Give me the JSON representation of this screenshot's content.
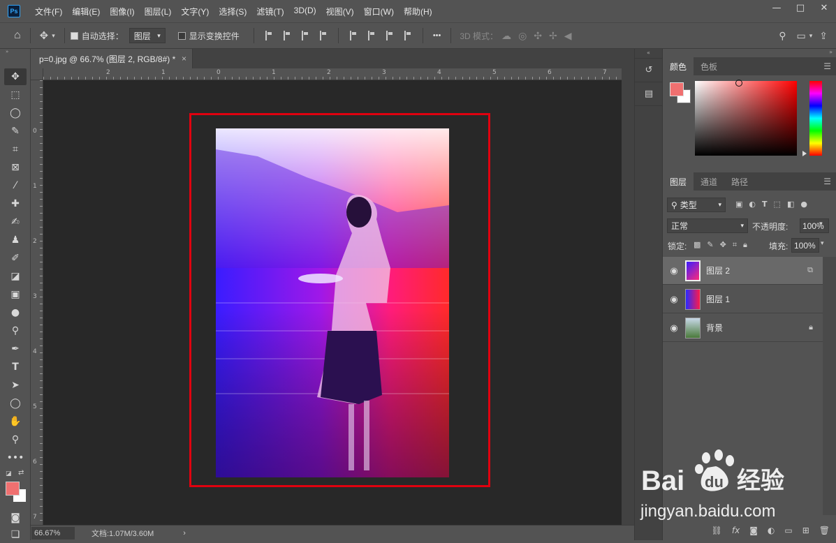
{
  "app": {
    "logo": "Ps"
  },
  "menubar": {
    "items": [
      "文件(F)",
      "编辑(E)",
      "图像(I)",
      "图层(L)",
      "文字(Y)",
      "选择(S)",
      "滤镜(T)",
      "3D(D)",
      "视图(V)",
      "窗口(W)",
      "帮助(H)"
    ]
  },
  "window_controls": {
    "minimize": "—",
    "maximize": "□",
    "close": "✕"
  },
  "options_bar": {
    "auto_select_label": "自动选择：",
    "auto_select_value": "图层",
    "show_transform_label": "显示变换控件",
    "more_label": "•••",
    "mode_3d_label": "3D 模式："
  },
  "document": {
    "tab_title": "p=0.jpg @ 66.7% (图层 2, RGB/8#) *",
    "close_glyph": "×"
  },
  "rulers": {
    "h_labels": [
      "2",
      "1",
      "0",
      "1",
      "2",
      "3",
      "4",
      "5",
      "6",
      "7"
    ],
    "v_labels": [
      "0",
      "1",
      "2",
      "3",
      "4",
      "5",
      "6",
      "7"
    ]
  },
  "status_bar": {
    "zoom": "66.67%",
    "doc_info": "文档:1.07M/3.60M",
    "arrow": "›"
  },
  "color_panel": {
    "tabs": [
      "颜色",
      "色板"
    ],
    "active_tab": "颜色",
    "foreground": "#f07070",
    "background": "#ffffff"
  },
  "layers_panel": {
    "tabs": [
      "图层",
      "通道",
      "路径"
    ],
    "active_tab": "图层",
    "filter_label": "类型",
    "blend_mode": "正常",
    "opacity_label": "不透明度:",
    "opacity_value": "100%",
    "lock_label": "锁定:",
    "fill_label": "填充:",
    "fill_value": "100%",
    "layers": [
      {
        "name": "图层 2",
        "selected": true
      },
      {
        "name": "图层 1",
        "selected": false
      },
      {
        "name": "背景",
        "selected": false
      }
    ]
  },
  "watermark": {
    "brand_bai": "Bai",
    "brand_du": "du",
    "brand_cn": "经验",
    "url": "jingyan.baidu.com"
  },
  "colors": {
    "highlight_box": "#e0000f",
    "canvas_bg": "#282828",
    "ui_bg": "#535353"
  }
}
